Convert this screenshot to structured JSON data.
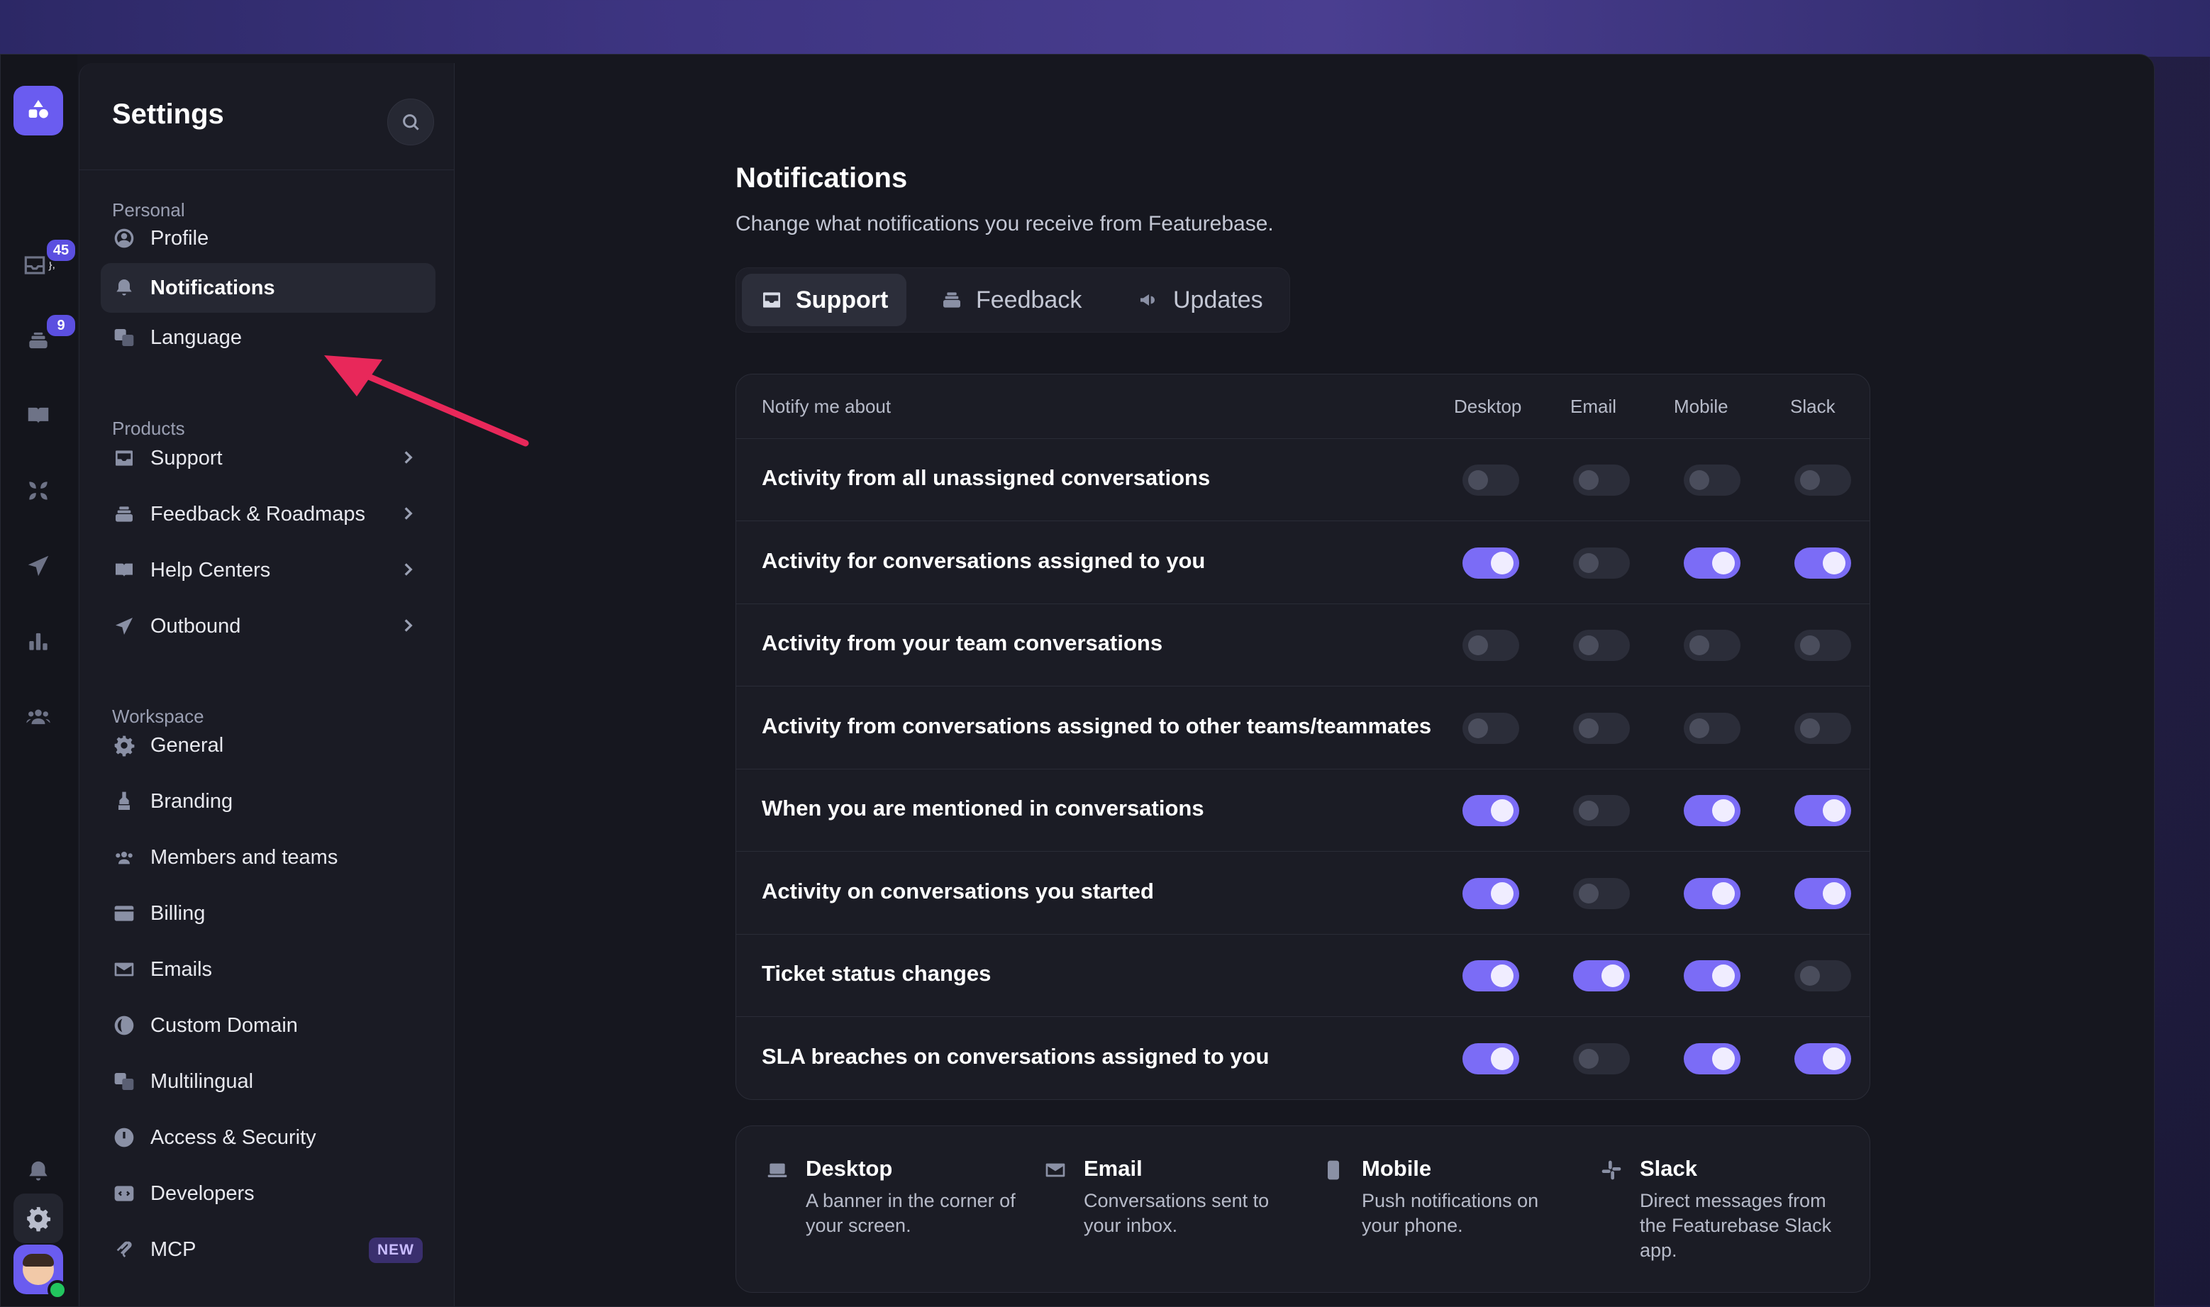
{
  "rail": {
    "badges": {
      "inbox": "45",
      "feedback": "9"
    }
  },
  "sidebar": {
    "title": "Settings",
    "sections": {
      "personal": "Personal",
      "products": "Products",
      "workspace": "Workspace"
    },
    "personal_items": [
      {
        "label": "Profile",
        "icon": "user-circle-icon"
      },
      {
        "label": "Notifications",
        "icon": "bell-icon",
        "active": true
      },
      {
        "label": "Language",
        "icon": "language-icon"
      }
    ],
    "product_items": [
      {
        "label": "Support",
        "icon": "inbox-icon"
      },
      {
        "label": "Feedback & Roadmaps",
        "icon": "stack-icon"
      },
      {
        "label": "Help Centers",
        "icon": "book-icon"
      },
      {
        "label": "Outbound",
        "icon": "paper-plane-icon"
      }
    ],
    "workspace_items": [
      {
        "label": "General",
        "icon": "gear-icon"
      },
      {
        "label": "Branding",
        "icon": "paint-icon"
      },
      {
        "label": "Members and teams",
        "icon": "users-icon"
      },
      {
        "label": "Billing",
        "icon": "credit-card-icon"
      },
      {
        "label": "Emails",
        "icon": "envelope-icon"
      },
      {
        "label": "Custom Domain",
        "icon": "globe-icon"
      },
      {
        "label": "Multilingual",
        "icon": "language-icon"
      },
      {
        "label": "Access & Security",
        "icon": "shield-icon"
      },
      {
        "label": "Developers",
        "icon": "code-icon"
      },
      {
        "label": "MCP",
        "icon": "mcp-icon",
        "badge": "NEW"
      }
    ]
  },
  "main": {
    "title": "Notifications",
    "subtitle": "Change what notifications you receive from Featurebase.",
    "tabs": [
      {
        "label": "Support",
        "active": true
      },
      {
        "label": "Feedback"
      },
      {
        "label": "Updates"
      }
    ],
    "table": {
      "header": "Notify me about",
      "columns": [
        "Desktop",
        "Email",
        "Mobile",
        "Slack"
      ],
      "rows": [
        {
          "label": "Activity from all unassigned conversations",
          "on": [
            false,
            false,
            false,
            false
          ]
        },
        {
          "label": "Activity for conversations assigned to you",
          "on": [
            true,
            false,
            true,
            true
          ]
        },
        {
          "label": "Activity from your team conversations",
          "on": [
            false,
            false,
            false,
            false
          ]
        },
        {
          "label": "Activity from conversations assigned to other teams/teammates",
          "on": [
            false,
            false,
            false,
            false
          ]
        },
        {
          "label": "When you are mentioned in conversations",
          "on": [
            true,
            false,
            true,
            true
          ]
        },
        {
          "label": "Activity on conversations you started",
          "on": [
            true,
            false,
            true,
            true
          ]
        },
        {
          "label": "Ticket status changes",
          "on": [
            true,
            true,
            true,
            false
          ]
        },
        {
          "label": "SLA breaches on conversations assigned to you",
          "on": [
            true,
            false,
            true,
            true
          ]
        }
      ]
    },
    "legend": [
      {
        "title": "Desktop",
        "desc": "A banner in the corner of your screen."
      },
      {
        "title": "Email",
        "desc": "Conversations sent to your inbox."
      },
      {
        "title": "Mobile",
        "desc": "Push notifications on your phone."
      },
      {
        "title": "Slack",
        "desc": "Direct messages from the Featurebase Slack app."
      }
    ]
  },
  "colors": {
    "accent": "#7b6cf6",
    "annotation_arrow": "#e8285a"
  }
}
